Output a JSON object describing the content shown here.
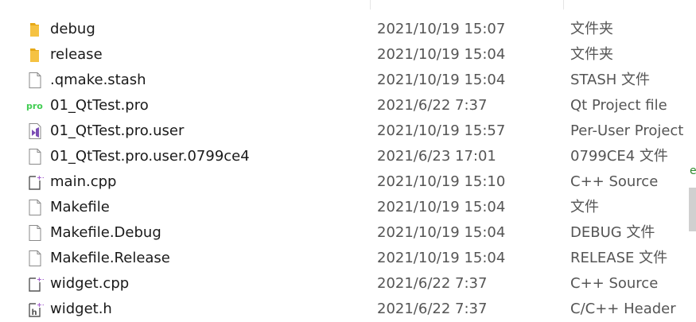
{
  "files": [
    {
      "name": "debug",
      "date": "2021/10/19 15:07",
      "type": "文件夹",
      "icon": "folder-icon"
    },
    {
      "name": "release",
      "date": "2021/10/19 15:04",
      "type": "文件夹",
      "icon": "folder-icon"
    },
    {
      "name": ".qmake.stash",
      "date": "2021/10/19 15:04",
      "type": "STASH 文件",
      "icon": "file-icon"
    },
    {
      "name": "01_QtTest.pro",
      "date": "2021/6/22 7:37",
      "type": "Qt Project file",
      "icon": "qt-pro-icon"
    },
    {
      "name": "01_QtTest.pro.user",
      "date": "2021/10/19 15:57",
      "type": "Per-User Project Cs",
      "icon": "visual-studio-file-icon"
    },
    {
      "name": "01_QtTest.pro.user.0799ce4",
      "date": "2021/6/23 17:01",
      "type": "0799CE4 文件",
      "icon": "file-icon"
    },
    {
      "name": "main.cpp",
      "date": "2021/10/19 15:10",
      "type": "C++ Source",
      "icon": "cpp-source-icon"
    },
    {
      "name": "Makefile",
      "date": "2021/10/19 15:04",
      "type": "文件",
      "icon": "file-icon"
    },
    {
      "name": "Makefile.Debug",
      "date": "2021/10/19 15:04",
      "type": "DEBUG 文件",
      "icon": "file-icon"
    },
    {
      "name": "Makefile.Release",
      "date": "2021/10/19 15:04",
      "type": "RELEASE 文件",
      "icon": "file-icon"
    },
    {
      "name": "widget.cpp",
      "date": "2021/6/22 7:37",
      "type": "C++ Source",
      "icon": "cpp-source-icon"
    },
    {
      "name": "widget.h",
      "date": "2021/6/22 7:37",
      "type": "C/C++ Header",
      "icon": "header-file-icon"
    }
  ],
  "side_glyph": "e",
  "colors": {
    "folder": "#f5c242",
    "qt_green": "#41cd52",
    "vs_purple": "#7b4db5",
    "cpp_purple": "#9a4fc9"
  }
}
